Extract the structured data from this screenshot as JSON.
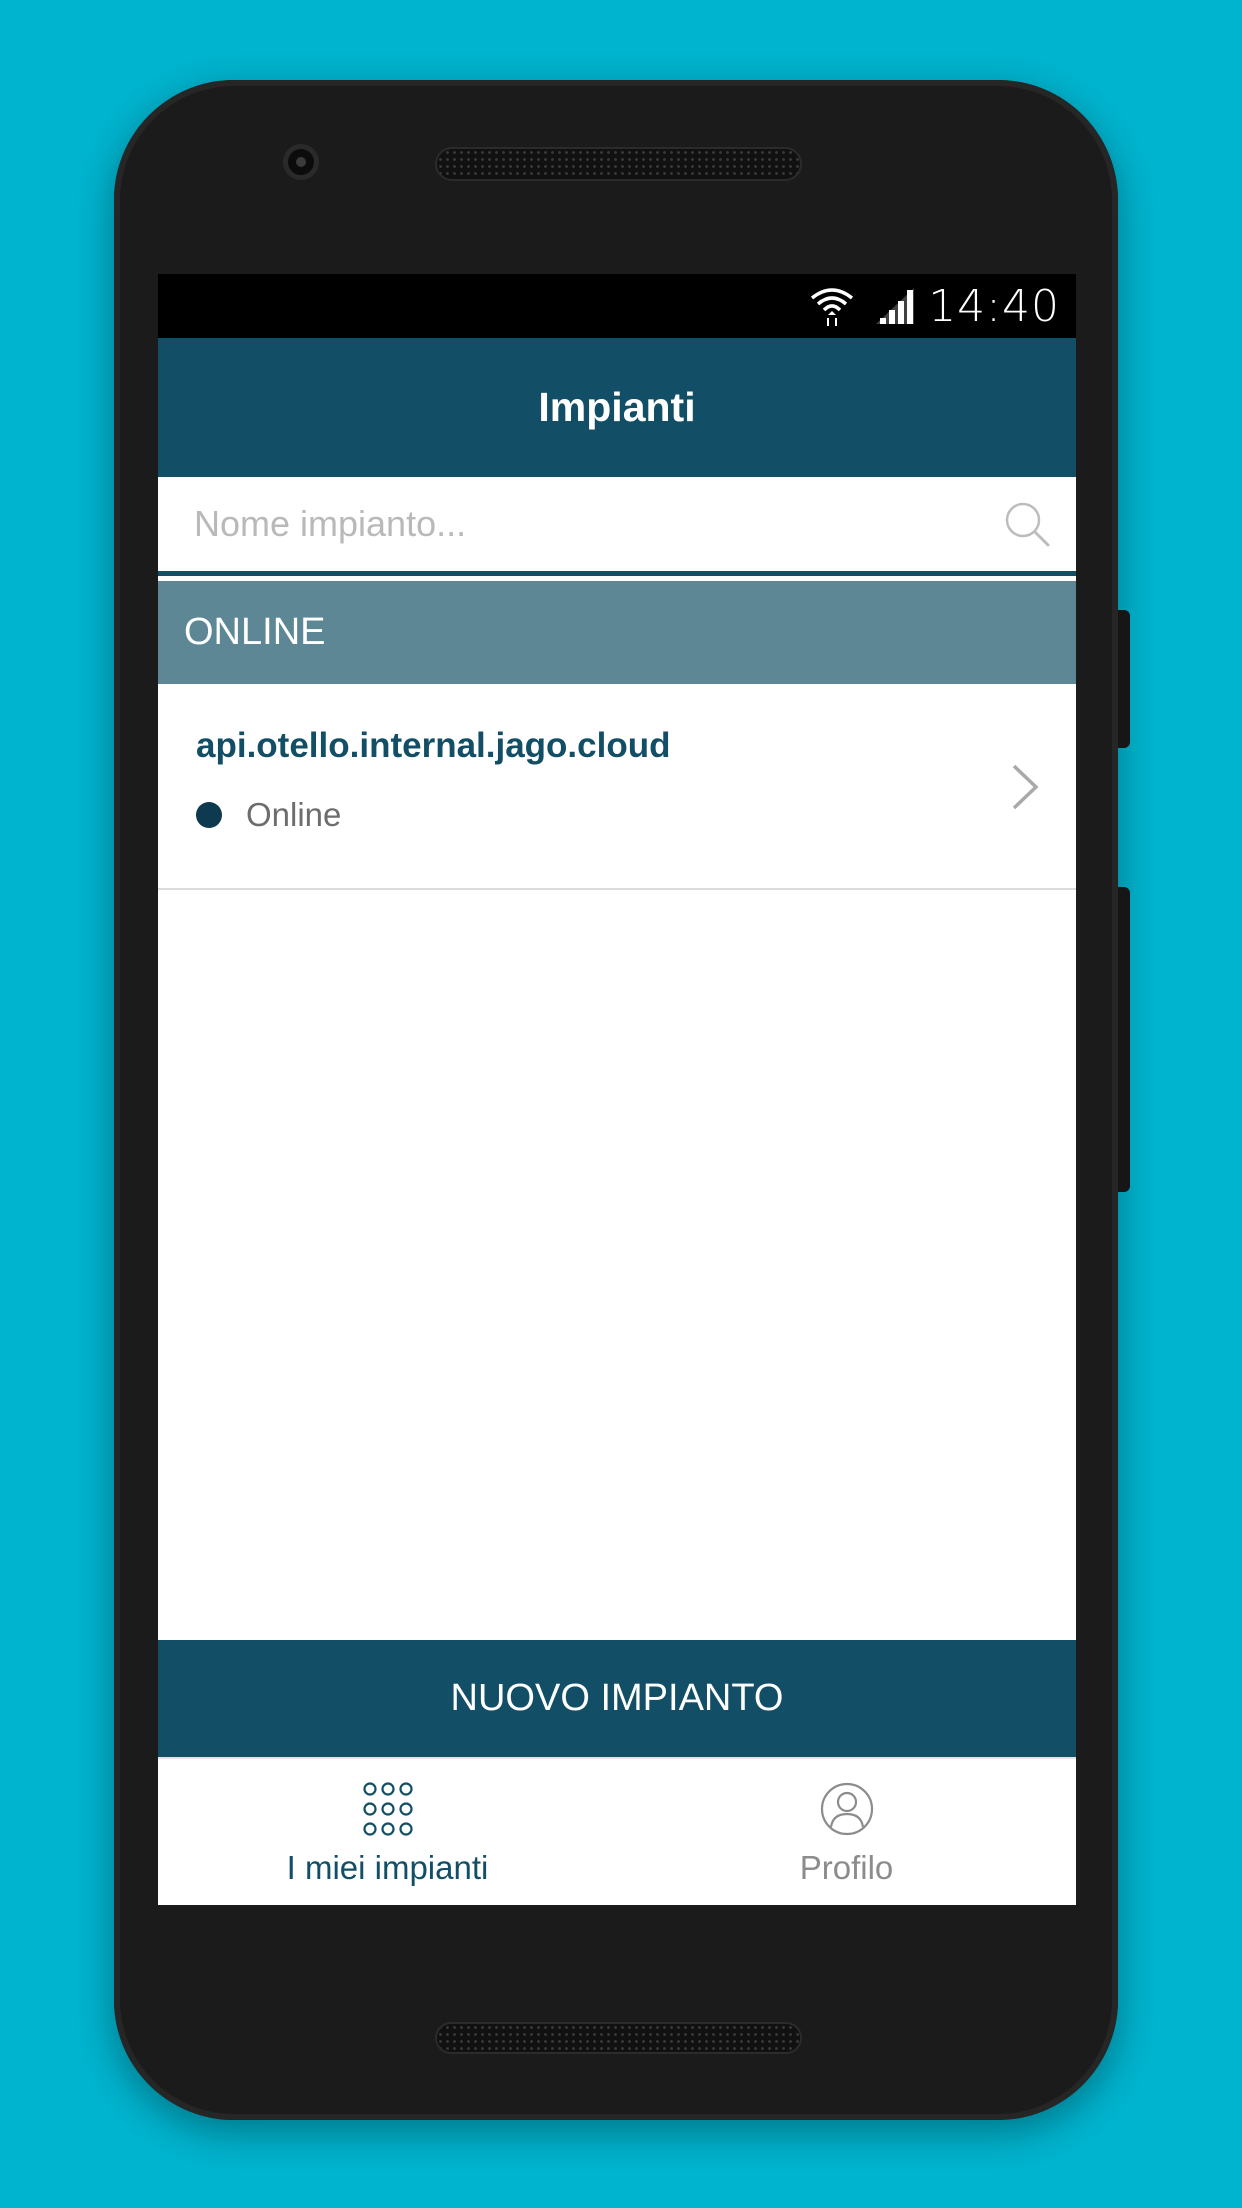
{
  "status_bar": {
    "time": "14:40",
    "wifi_icon": "wifi-icon",
    "signal_icon": "signal-icon"
  },
  "app_bar": {
    "title": "Impianti"
  },
  "search": {
    "placeholder": "Nome impianto...",
    "value": "",
    "icon": "search-icon"
  },
  "section": {
    "label": "ONLINE"
  },
  "plants": [
    {
      "name": "api.otello.internal.jago.cloud",
      "status": "Online",
      "status_color": "#0e3a4f"
    }
  ],
  "new_button": {
    "label": "NUOVO IMPIANTO"
  },
  "bottom_nav": {
    "items": [
      {
        "label": "I miei impianti",
        "icon": "grid-icon",
        "active": true
      },
      {
        "label": "Profilo",
        "icon": "profile-icon",
        "active": false
      }
    ]
  },
  "colors": {
    "background": "#00b4cf",
    "primary": "#124f66",
    "section": "#5e8796"
  }
}
